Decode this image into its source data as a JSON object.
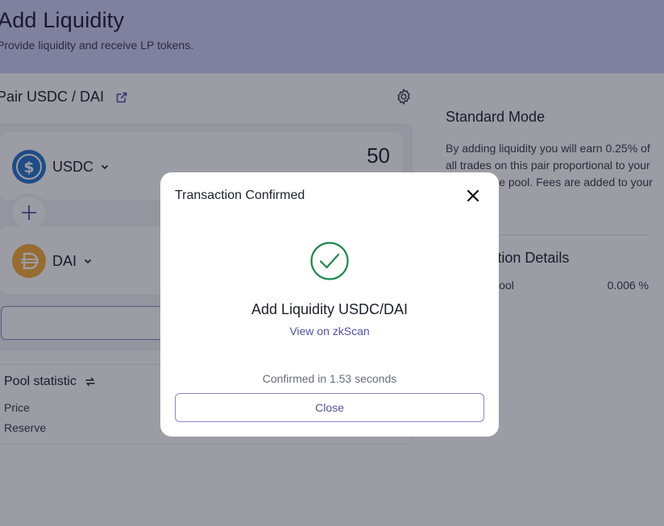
{
  "page": {
    "title": "Add Liquidity",
    "subtitle": "Provide liquidity and receive LP tokens."
  },
  "pair": {
    "title": "Pair USDC / DAI"
  },
  "tokens": [
    {
      "symbol": "USDC",
      "amount": "50",
      "color": "#2775ca"
    },
    {
      "symbol": "DAI",
      "amount": "",
      "color": "#f5ac37"
    }
  ],
  "pool_statistic": {
    "title": "Pool statistic",
    "price_label": "Price",
    "reserve_label": "Reserve"
  },
  "standard_mode": {
    "title": "Standard Mode",
    "description": "By adding liquidity you will earn 0.25% of all trades on this pair proportional to your share of the pool. Fees are added to your principal in"
  },
  "transaction_details": {
    "title": "Transaction Details",
    "share_label": "Share of Pool",
    "share_value": "0.006 %"
  },
  "modal": {
    "title": "Transaction Confirmed",
    "heading": "Add Liquidity USDC/DAI",
    "link": "View on zkScan",
    "status": "Confirmed in 1.53 seconds",
    "close_label": "Close"
  },
  "colors": {
    "accent": "#4f52a3",
    "success": "#1f8a4c",
    "banner": "#cfd0f5"
  }
}
